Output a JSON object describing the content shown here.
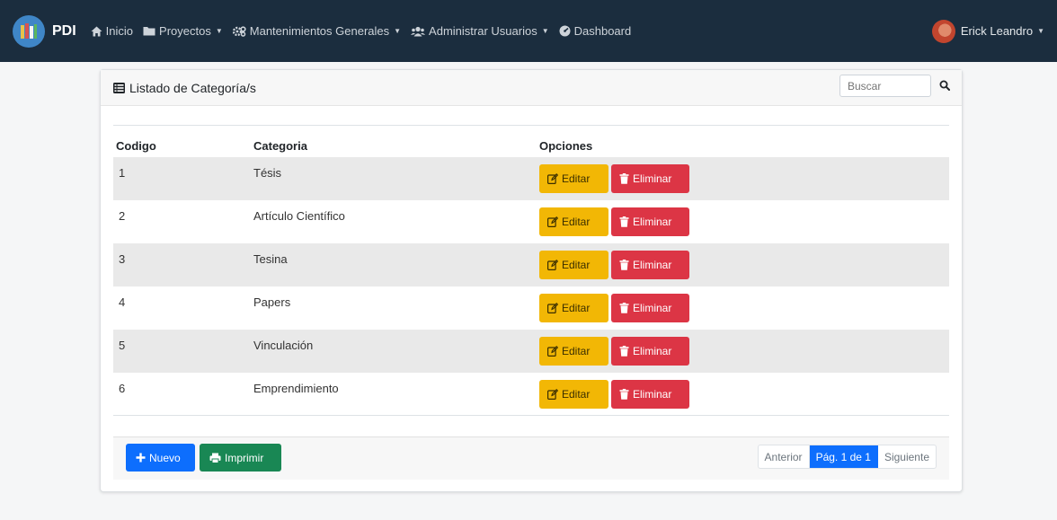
{
  "nav": {
    "brand": "PDI",
    "items": [
      {
        "label": "Inicio",
        "icon": "home-icon",
        "dropdown": false
      },
      {
        "label": "Proyectos",
        "icon": "folder-icon",
        "dropdown": true
      },
      {
        "label": "Mantenimientos Generales",
        "icon": "cogs-icon",
        "dropdown": true
      },
      {
        "label": "Administrar Usuarios",
        "icon": "users-icon",
        "dropdown": true
      },
      {
        "label": "Dashboard",
        "icon": "dashboard-icon",
        "dropdown": false
      }
    ],
    "user": "Erick Leandro"
  },
  "card": {
    "title": "Listado de Categoría/s",
    "search_placeholder": "Buscar"
  },
  "table": {
    "headers": [
      "Codigo",
      "Categoria",
      "Opciones"
    ],
    "rows": [
      {
        "code": "1",
        "name": "Tésis"
      },
      {
        "code": "2",
        "name": "Artículo Científico"
      },
      {
        "code": "3",
        "name": "Tesina"
      },
      {
        "code": "4",
        "name": "Papers"
      },
      {
        "code": "5",
        "name": "Vinculación"
      },
      {
        "code": "6",
        "name": "Emprendimiento"
      }
    ],
    "edit_label": "Editar",
    "delete_label": "Eliminar"
  },
  "footer": {
    "new_label": "Nuevo",
    "print_label": "Imprimir",
    "pager": {
      "prev": "Anterior",
      "current": "Pág. 1 de 1",
      "next": "Siguiente"
    }
  },
  "colors": {
    "navbar": "#1b2d3e",
    "edit": "#f2b705",
    "delete": "#dc3545",
    "primary": "#0d6efd",
    "success": "#198754"
  }
}
